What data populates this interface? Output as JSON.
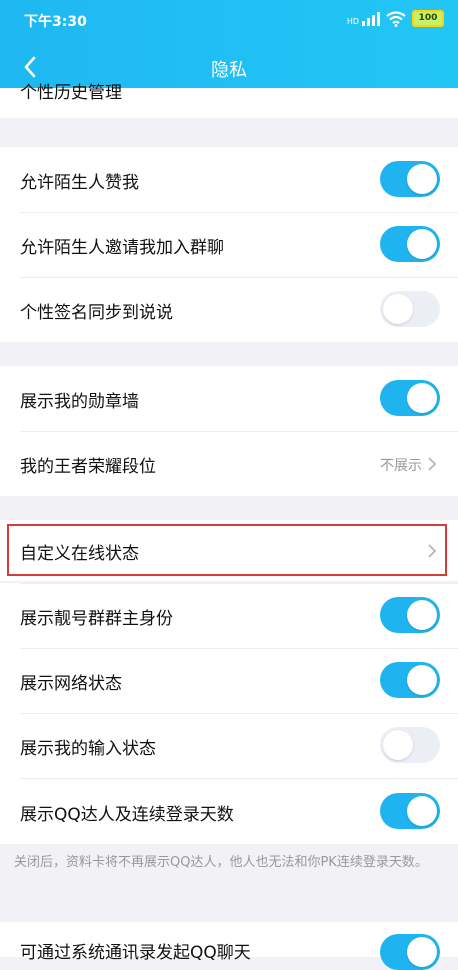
{
  "status_bar": {
    "time": "下午3:30",
    "signal": "HD",
    "battery": "100"
  },
  "nav": {
    "title": "隐私"
  },
  "cut_top_label": "个性历史管理",
  "groups": [
    {
      "items": [
        {
          "label": "允许陌生人赞我",
          "toggle": true
        },
        {
          "label": "允许陌生人邀请我加入群聊",
          "toggle": true
        },
        {
          "label": "个性签名同步到说说",
          "toggle": false
        }
      ]
    },
    {
      "items": [
        {
          "label": "展示我的勋章墙",
          "toggle": true
        },
        {
          "label": "我的王者荣耀段位",
          "value": "不展示"
        }
      ]
    },
    {
      "items": [
        {
          "label": "自定义在线状态"
        },
        {
          "label": "展示靓号群群主身份",
          "toggle": true
        },
        {
          "label": "展示网络状态",
          "toggle": true
        },
        {
          "label": "展示我的输入状态",
          "toggle": false
        },
        {
          "label": "展示QQ达人及连续登录天数",
          "toggle": true
        }
      ]
    }
  ],
  "note": "关闭后，资料卡将不再展示QQ达人，他人也无法和你PK连续登录天数。",
  "bottom_cut_label": "可通过系统通讯录发起QQ聊天",
  "colors": {
    "accent": "#1fb4ef",
    "highlight": "#d93a3a"
  }
}
